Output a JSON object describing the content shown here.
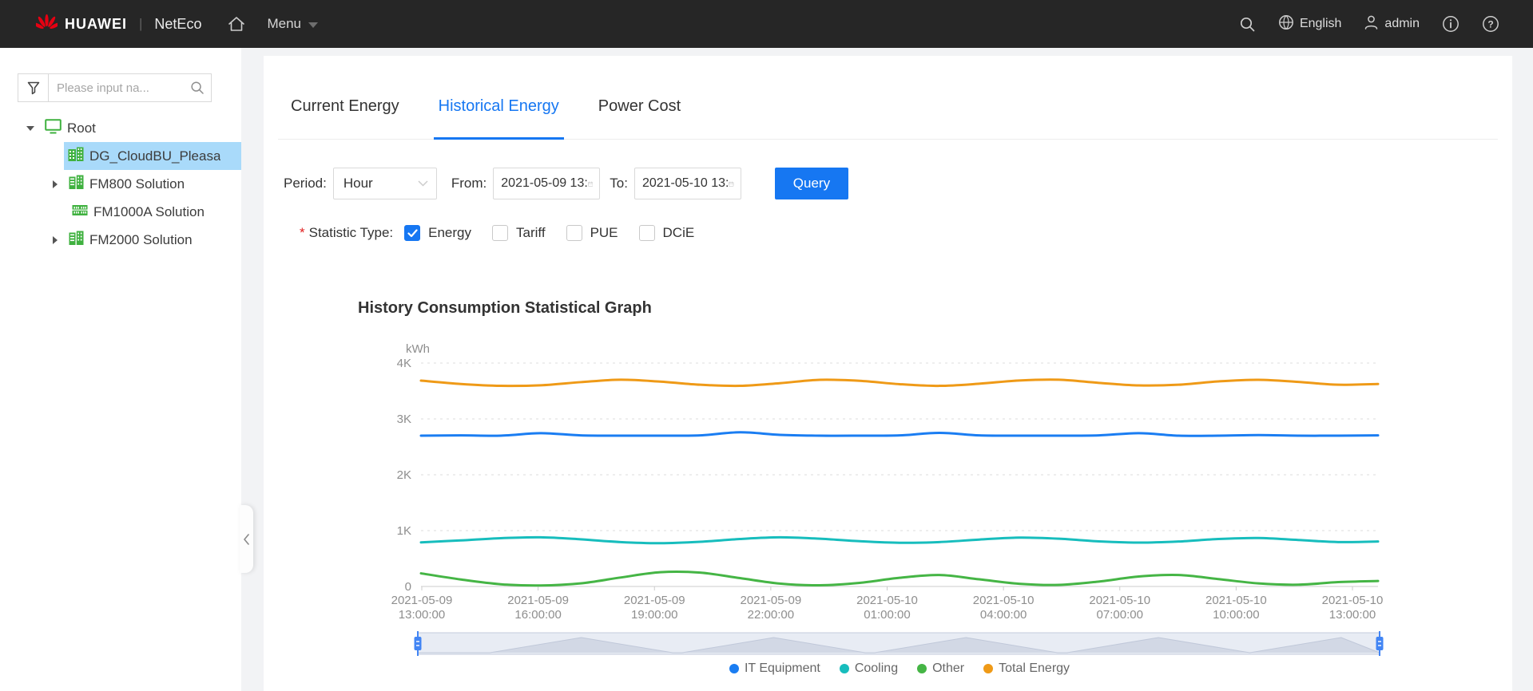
{
  "topbar": {
    "brand": "HUAWEI",
    "divider": "|",
    "product": "NetEco",
    "menu_label": "Menu",
    "language": "English",
    "user": "admin"
  },
  "sidebar": {
    "search_placeholder": "Please input na...",
    "tree": [
      {
        "label": "Root",
        "icon": "monitor-icon",
        "state": "expanded"
      },
      {
        "label": "DG_CloudBU_Pleasa",
        "icon": "building-icon",
        "state": "selected"
      },
      {
        "label": "FM800 Solution",
        "icon": "buildings-icon",
        "state": "collapsed"
      },
      {
        "label": "FM1000A Solution",
        "icon": "server-icon",
        "state": "leaf"
      },
      {
        "label": "FM2000 Solution",
        "icon": "buildings-icon",
        "state": "collapsed"
      }
    ]
  },
  "tabs": [
    {
      "label": "Current Energy",
      "active": false
    },
    {
      "label": "Historical Energy",
      "active": true
    },
    {
      "label": "Power Cost",
      "active": false
    }
  ],
  "filters": {
    "period_label": "Period:",
    "period_value": "Hour",
    "from_label": "From:",
    "from_value": "2021-05-09 13:",
    "to_label": "To:",
    "to_value": "2021-05-10 13:",
    "query_label": "Query"
  },
  "statistic": {
    "required_mark": "*",
    "label": "Statistic Type:",
    "options": [
      {
        "label": "Energy",
        "checked": true
      },
      {
        "label": "Tariff",
        "checked": false
      },
      {
        "label": "PUE",
        "checked": false
      },
      {
        "label": "DCiE",
        "checked": false
      }
    ]
  },
  "colors": {
    "accent": "#1677f2",
    "topbar_bg": "#262626",
    "tree_icon_green": "#3fb13f",
    "selected_row_bg": "#a9dafa",
    "grid_line": "#dcdcdc",
    "axis_text": "#8e8e8e"
  },
  "chart_data": {
    "type": "line",
    "title": "History Consumption Statistical Graph",
    "y_unit": "kWh",
    "ylim": [
      0,
      4000
    ],
    "y_ticks": [
      "4K",
      "3K",
      "2K",
      "1K",
      "0"
    ],
    "grid": "dashed-horizontal",
    "legend_position": "bottom",
    "x_tick_labels": [
      [
        "2021-05-09",
        "13:00:00"
      ],
      [
        "2021-05-09",
        "16:00:00"
      ],
      [
        "2021-05-09",
        "19:00:00"
      ],
      [
        "2021-05-09",
        "22:00:00"
      ],
      [
        "2021-05-10",
        "01:00:00"
      ],
      [
        "2021-05-10",
        "04:00:00"
      ],
      [
        "2021-05-10",
        "07:00:00"
      ],
      [
        "2021-05-10",
        "10:00:00"
      ],
      [
        "2021-05-10",
        "13:00:00"
      ]
    ],
    "x_count": 25,
    "series": [
      {
        "name": "IT Equipment",
        "color": "#1a7df2",
        "values": [
          2700,
          2705,
          2700,
          2745,
          2705,
          2700,
          2700,
          2705,
          2760,
          2715,
          2700,
          2700,
          2705,
          2750,
          2705,
          2700,
          2700,
          2705,
          2745,
          2700,
          2700,
          2710,
          2700,
          2700,
          2705
        ]
      },
      {
        "name": "Cooling",
        "color": "#17bdbd",
        "values": [
          790,
          825,
          865,
          880,
          845,
          795,
          775,
          800,
          850,
          880,
          855,
          810,
          782,
          795,
          840,
          875,
          855,
          808,
          785,
          805,
          850,
          868,
          832,
          795,
          805
        ]
      },
      {
        "name": "Other",
        "color": "#45b545",
        "values": [
          235,
          125,
          40,
          18,
          55,
          160,
          255,
          248,
          150,
          52,
          22,
          65,
          155,
          205,
          128,
          48,
          28,
          88,
          178,
          205,
          132,
          55,
          32,
          78,
          98
        ]
      },
      {
        "name": "Total Energy",
        "color": "#ef9a17",
        "values": [
          3685,
          3625,
          3592,
          3602,
          3658,
          3702,
          3668,
          3612,
          3592,
          3640,
          3700,
          3682,
          3622,
          3592,
          3630,
          3688,
          3702,
          3645,
          3600,
          3612,
          3672,
          3700,
          3662,
          3612,
          3625
        ]
      }
    ]
  }
}
